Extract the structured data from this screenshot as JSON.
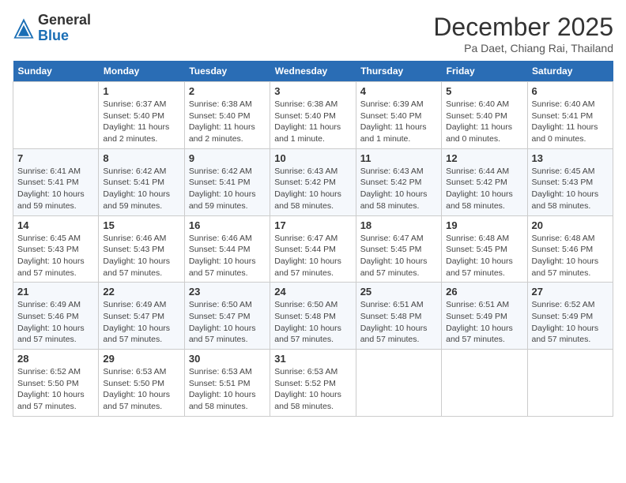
{
  "logo": {
    "general": "General",
    "blue": "Blue"
  },
  "title": "December 2025",
  "subtitle": "Pa Daet, Chiang Rai, Thailand",
  "weekdays": [
    "Sunday",
    "Monday",
    "Tuesday",
    "Wednesday",
    "Thursday",
    "Friday",
    "Saturday"
  ],
  "weeks": [
    [
      {
        "num": "",
        "info": ""
      },
      {
        "num": "1",
        "info": "Sunrise: 6:37 AM\nSunset: 5:40 PM\nDaylight: 11 hours\nand 2 minutes."
      },
      {
        "num": "2",
        "info": "Sunrise: 6:38 AM\nSunset: 5:40 PM\nDaylight: 11 hours\nand 2 minutes."
      },
      {
        "num": "3",
        "info": "Sunrise: 6:38 AM\nSunset: 5:40 PM\nDaylight: 11 hours\nand 1 minute."
      },
      {
        "num": "4",
        "info": "Sunrise: 6:39 AM\nSunset: 5:40 PM\nDaylight: 11 hours\nand 1 minute."
      },
      {
        "num": "5",
        "info": "Sunrise: 6:40 AM\nSunset: 5:40 PM\nDaylight: 11 hours\nand 0 minutes."
      },
      {
        "num": "6",
        "info": "Sunrise: 6:40 AM\nSunset: 5:41 PM\nDaylight: 11 hours\nand 0 minutes."
      }
    ],
    [
      {
        "num": "7",
        "info": "Sunrise: 6:41 AM\nSunset: 5:41 PM\nDaylight: 10 hours\nand 59 minutes."
      },
      {
        "num": "8",
        "info": "Sunrise: 6:42 AM\nSunset: 5:41 PM\nDaylight: 10 hours\nand 59 minutes."
      },
      {
        "num": "9",
        "info": "Sunrise: 6:42 AM\nSunset: 5:41 PM\nDaylight: 10 hours\nand 59 minutes."
      },
      {
        "num": "10",
        "info": "Sunrise: 6:43 AM\nSunset: 5:42 PM\nDaylight: 10 hours\nand 58 minutes."
      },
      {
        "num": "11",
        "info": "Sunrise: 6:43 AM\nSunset: 5:42 PM\nDaylight: 10 hours\nand 58 minutes."
      },
      {
        "num": "12",
        "info": "Sunrise: 6:44 AM\nSunset: 5:42 PM\nDaylight: 10 hours\nand 58 minutes."
      },
      {
        "num": "13",
        "info": "Sunrise: 6:45 AM\nSunset: 5:43 PM\nDaylight: 10 hours\nand 58 minutes."
      }
    ],
    [
      {
        "num": "14",
        "info": "Sunrise: 6:45 AM\nSunset: 5:43 PM\nDaylight: 10 hours\nand 57 minutes."
      },
      {
        "num": "15",
        "info": "Sunrise: 6:46 AM\nSunset: 5:43 PM\nDaylight: 10 hours\nand 57 minutes."
      },
      {
        "num": "16",
        "info": "Sunrise: 6:46 AM\nSunset: 5:44 PM\nDaylight: 10 hours\nand 57 minutes."
      },
      {
        "num": "17",
        "info": "Sunrise: 6:47 AM\nSunset: 5:44 PM\nDaylight: 10 hours\nand 57 minutes."
      },
      {
        "num": "18",
        "info": "Sunrise: 6:47 AM\nSunset: 5:45 PM\nDaylight: 10 hours\nand 57 minutes."
      },
      {
        "num": "19",
        "info": "Sunrise: 6:48 AM\nSunset: 5:45 PM\nDaylight: 10 hours\nand 57 minutes."
      },
      {
        "num": "20",
        "info": "Sunrise: 6:48 AM\nSunset: 5:46 PM\nDaylight: 10 hours\nand 57 minutes."
      }
    ],
    [
      {
        "num": "21",
        "info": "Sunrise: 6:49 AM\nSunset: 5:46 PM\nDaylight: 10 hours\nand 57 minutes."
      },
      {
        "num": "22",
        "info": "Sunrise: 6:49 AM\nSunset: 5:47 PM\nDaylight: 10 hours\nand 57 minutes."
      },
      {
        "num": "23",
        "info": "Sunrise: 6:50 AM\nSunset: 5:47 PM\nDaylight: 10 hours\nand 57 minutes."
      },
      {
        "num": "24",
        "info": "Sunrise: 6:50 AM\nSunset: 5:48 PM\nDaylight: 10 hours\nand 57 minutes."
      },
      {
        "num": "25",
        "info": "Sunrise: 6:51 AM\nSunset: 5:48 PM\nDaylight: 10 hours\nand 57 minutes."
      },
      {
        "num": "26",
        "info": "Sunrise: 6:51 AM\nSunset: 5:49 PM\nDaylight: 10 hours\nand 57 minutes."
      },
      {
        "num": "27",
        "info": "Sunrise: 6:52 AM\nSunset: 5:49 PM\nDaylight: 10 hours\nand 57 minutes."
      }
    ],
    [
      {
        "num": "28",
        "info": "Sunrise: 6:52 AM\nSunset: 5:50 PM\nDaylight: 10 hours\nand 57 minutes."
      },
      {
        "num": "29",
        "info": "Sunrise: 6:53 AM\nSunset: 5:50 PM\nDaylight: 10 hours\nand 57 minutes."
      },
      {
        "num": "30",
        "info": "Sunrise: 6:53 AM\nSunset: 5:51 PM\nDaylight: 10 hours\nand 58 minutes."
      },
      {
        "num": "31",
        "info": "Sunrise: 6:53 AM\nSunset: 5:52 PM\nDaylight: 10 hours\nand 58 minutes."
      },
      {
        "num": "",
        "info": ""
      },
      {
        "num": "",
        "info": ""
      },
      {
        "num": "",
        "info": ""
      }
    ]
  ]
}
